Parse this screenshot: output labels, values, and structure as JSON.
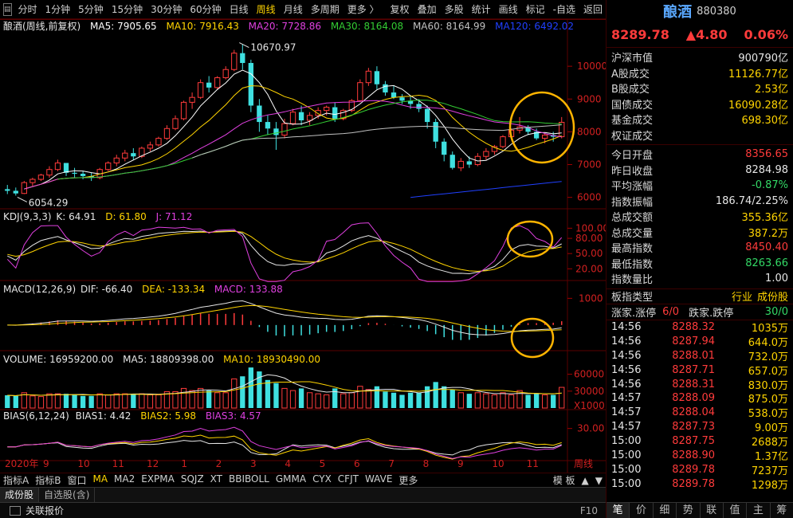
{
  "toolbar": {
    "periods": [
      "分时",
      "1分钟",
      "5分钟",
      "15分钟",
      "30分钟",
      "60分钟",
      "日线",
      "周线",
      "月线",
      "多周期",
      "更多 〉"
    ],
    "active_period": "周线",
    "tools": [
      "复权",
      "叠加",
      "多股",
      "统计",
      "画线",
      "标记",
      "-自选",
      "返回"
    ]
  },
  "main_legend": {
    "title": "酿酒(周线,前复权)",
    "ma5": "MA5: 7905.65",
    "ma10": "MA10: 7916.43",
    "ma20": "MA20: 7728.86",
    "ma30": "MA30: 8164.08",
    "ma60": "MA60: 8164.99",
    "ma120": "MA120: 6492.02"
  },
  "colors": {
    "up": "#ff3b3b",
    "down": "#3fe0e0",
    "ma5": "#ffffff",
    "ma10": "#ffd400",
    "ma20": "#e040e0",
    "ma30": "#33cc33",
    "ma60": "#c0c0c0",
    "ma120": "#2040ff",
    "highlight_circle": "#ffb400"
  },
  "annotations": {
    "high_label": "10670.97",
    "low_label": "6054.29"
  },
  "axes": {
    "price_ticks": [
      "10000",
      "9000",
      "8000",
      "7000",
      "6000"
    ],
    "kdj_ticks": [
      "100.00",
      "80.00",
      "50.00",
      "20.00"
    ],
    "macd_ticks": [
      "1000"
    ],
    "volume_ticks": [
      "60000",
      "30000",
      "X1000"
    ],
    "bias_ticks": [
      "30.00"
    ],
    "x_year": "2020年",
    "x_months": [
      "9",
      "10",
      "11",
      "12",
      "1",
      "2",
      "3",
      "4",
      "5",
      "6",
      "7",
      "8",
      "9",
      "10",
      "11"
    ],
    "x_period_label": "周线"
  },
  "kdj_legend": {
    "name": "KDJ(9,3,3)",
    "k": "K: 64.91",
    "d": "D: 61.80",
    "j": "J: 71.12"
  },
  "macd_legend": {
    "name": "MACD(12,26,9)",
    "dif": "DIF: -66.40",
    "dea": "DEA: -133.34",
    "macd": "MACD: 133.88"
  },
  "volume_legend": {
    "name": "VOLUME: 16959200.00",
    "ma5": "MA5: 18809398.00",
    "ma10": "MA10: 18930490.00"
  },
  "bias_legend": {
    "name": "BIAS(6,12,24)",
    "b1": "BIAS1: 4.42",
    "b2": "BIAS2: 5.98",
    "b3": "BIAS3: 4.57"
  },
  "chart_data": {
    "type": "candlestick",
    "period": "weekly",
    "y_range": [
      5700,
      11000
    ],
    "candles": [
      [
        6250,
        6380,
        6100,
        6200
      ],
      [
        6200,
        6300,
        6054,
        6120
      ],
      [
        6120,
        6500,
        6100,
        6450
      ],
      [
        6450,
        6600,
        6350,
        6550
      ],
      [
        6550,
        6720,
        6500,
        6680
      ],
      [
        6680,
        6950,
        6600,
        6850
      ],
      [
        6850,
        7150,
        6800,
        7050
      ],
      [
        7050,
        7000,
        6650,
        6750
      ],
      [
        6750,
        6900,
        6600,
        6720
      ],
      [
        6720,
        6800,
        6550,
        6650
      ],
      [
        6650,
        6750,
        6500,
        6600
      ],
      [
        6600,
        6900,
        6550,
        6850
      ],
      [
        6850,
        7100,
        6800,
        7050
      ],
      [
        7050,
        7300,
        6950,
        7200
      ],
      [
        7200,
        7450,
        7100,
        7350
      ],
      [
        7350,
        7500,
        7150,
        7250
      ],
      [
        7250,
        7550,
        7200,
        7500
      ],
      [
        7500,
        7700,
        7400,
        7600
      ],
      [
        7600,
        7850,
        7550,
        7800
      ],
      [
        7800,
        8200,
        7750,
        8100
      ],
      [
        8100,
        8500,
        8050,
        8400
      ],
      [
        8400,
        8950,
        8350,
        8900
      ],
      [
        8900,
        9200,
        8700,
        9050
      ],
      [
        9050,
        9600,
        9000,
        9500
      ],
      [
        9500,
        9700,
        9200,
        9350
      ],
      [
        9350,
        9700,
        9300,
        9650
      ],
      [
        9650,
        10000,
        9600,
        9900
      ],
      [
        9900,
        10500,
        9850,
        10400
      ],
      [
        10400,
        10670.97,
        9900,
        10100
      ],
      [
        10100,
        10200,
        8600,
        8800
      ],
      [
        8800,
        9000,
        8000,
        8300
      ],
      [
        8300,
        8500,
        7900,
        8100
      ],
      [
        8100,
        8300,
        7450,
        7900
      ],
      [
        7900,
        8400,
        7800,
        8250
      ],
      [
        8250,
        8700,
        8200,
        8600
      ],
      [
        8600,
        8800,
        8200,
        8350
      ],
      [
        8350,
        8600,
        8200,
        8500
      ],
      [
        8500,
        8750,
        8400,
        8650
      ],
      [
        8650,
        8800,
        8500,
        8750
      ],
      [
        8750,
        8900,
        8300,
        8400
      ],
      [
        8400,
        8700,
        8350,
        8650
      ],
      [
        8650,
        9000,
        8600,
        8950
      ],
      [
        8950,
        9600,
        8900,
        9500
      ],
      [
        9500,
        9950,
        9400,
        9850
      ],
      [
        9850,
        10000,
        9300,
        9450
      ],
      [
        9450,
        9550,
        9100,
        9200
      ],
      [
        9200,
        9400,
        9000,
        9050
      ],
      [
        9050,
        9150,
        8850,
        8950
      ],
      [
        8950,
        9100,
        8700,
        8850
      ],
      [
        8850,
        9000,
        8600,
        8700
      ],
      [
        8700,
        8800,
        8100,
        8300
      ],
      [
        8300,
        8400,
        7500,
        7700
      ],
      [
        7700,
        7800,
        7100,
        7300
      ],
      [
        7300,
        7400,
        6850,
        6900
      ],
      [
        6900,
        7200,
        6800,
        7100
      ],
      [
        7100,
        7250,
        6900,
        7000
      ],
      [
        7000,
        7350,
        6950,
        7250
      ],
      [
        7250,
        7500,
        7150,
        7400
      ],
      [
        7400,
        7600,
        7300,
        7550
      ],
      [
        7550,
        7900,
        7500,
        7850
      ],
      [
        7850,
        8100,
        7800,
        8050
      ],
      [
        8050,
        8450,
        7950,
        8150
      ],
      [
        8150,
        8200,
        7900,
        8000
      ],
      [
        8000,
        8100,
        7750,
        7800
      ],
      [
        7800,
        7950,
        7650,
        7900
      ],
      [
        7900,
        8000,
        7700,
        7850
      ],
      [
        7850,
        8450.4,
        7800,
        8289.78
      ]
    ],
    "volume_ylim": [
      0,
      75000
    ],
    "kdj_ylim": [
      0,
      110
    ],
    "macd_ylim": [
      -900,
      1100
    ],
    "bias_ylim": [
      -20,
      40
    ]
  },
  "right_panel": {
    "name": "酿酒",
    "code": "880380",
    "price": "8289.78",
    "change": "▲4.80",
    "pct": "0.06%",
    "market_rows": [
      {
        "label": "沪深市值",
        "value": "900790亿",
        "color": "white"
      },
      {
        "label": "A股成交",
        "value": "11126.77亿",
        "color": "yellow"
      },
      {
        "label": "B股成交",
        "value": "2.53亿",
        "color": "yellow"
      },
      {
        "label": "国债成交",
        "value": "16090.28亿",
        "color": "yellow"
      },
      {
        "label": "基金成交",
        "value": "698.30亿",
        "color": "yellow"
      },
      {
        "label": "权证成交",
        "value": "",
        "color": "yellow"
      }
    ],
    "index_rows": [
      {
        "label": "今日开盘",
        "value": "8356.65",
        "color": "red"
      },
      {
        "label": "昨日收盘",
        "value": "8284.98",
        "color": "white"
      },
      {
        "label": "平均涨幅",
        "value": "-0.87%",
        "color": "green"
      },
      {
        "label": "指数振幅",
        "value": "186.74/2.25%",
        "color": "white"
      },
      {
        "label": "总成交额",
        "value": "355.36亿",
        "color": "yellow"
      },
      {
        "label": "总成交量",
        "value": "387.2万",
        "color": "yellow"
      },
      {
        "label": "最高指数",
        "value": "8450.40",
        "color": "red"
      },
      {
        "label": "最低指数",
        "value": "8263.66",
        "color": "green"
      },
      {
        "label": "指数量比",
        "value": "1.00",
        "color": "white"
      }
    ],
    "board": {
      "label": "板指类型",
      "v1": "行业",
      "v2": "成份股"
    },
    "updown": {
      "label": "涨家.涨停",
      "up": "6/0",
      "dlabel": "跌家.跌停",
      "dn": "30/0"
    },
    "ticks": [
      {
        "t": "14:56",
        "p": "8288.32",
        "v": "1035万"
      },
      {
        "t": "14:56",
        "p": "8287.94",
        "v": "644.0万"
      },
      {
        "t": "14:56",
        "p": "8288.01",
        "v": "732.0万"
      },
      {
        "t": "14:56",
        "p": "8287.71",
        "v": "657.0万"
      },
      {
        "t": "14:56",
        "p": "8288.31",
        "v": "830.0万"
      },
      {
        "t": "14:57",
        "p": "8288.09",
        "v": "875.0万"
      },
      {
        "t": "14:57",
        "p": "8288.04",
        "v": "538.0万"
      },
      {
        "t": "14:57",
        "p": "8287.73",
        "v": "9.00万"
      },
      {
        "t": "15:00",
        "p": "8287.75",
        "v": "2688万"
      },
      {
        "t": "15:00",
        "p": "8288.90",
        "v": "1.37亿"
      },
      {
        "t": "15:00",
        "p": "8289.78",
        "v": "7237万"
      },
      {
        "t": "15:00",
        "p": "8289.78",
        "v": "1298万"
      }
    ],
    "tabs": [
      "笔",
      "价",
      "细",
      "势",
      "联",
      "值",
      "主",
      "筹"
    ]
  },
  "indicator_bar": {
    "items": [
      "指标A",
      "指标B",
      "窗口",
      "MA",
      "MA2",
      "EXPMA",
      "SQJZ",
      "XT",
      "BBIBOLL",
      "GMMA",
      "CYX",
      "CFJT",
      "WAVE",
      "更多"
    ],
    "active": "MA",
    "right": [
      "模 板",
      "▲",
      "▼"
    ]
  },
  "stock_tabs": [
    "成份股",
    "自选股(含)"
  ],
  "status_bar": {
    "label": "关联报价",
    "right": "F10"
  }
}
